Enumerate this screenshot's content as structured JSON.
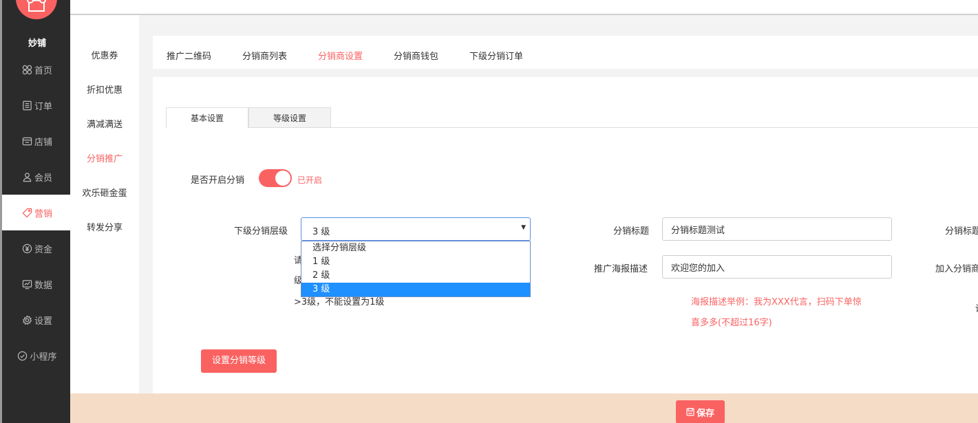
{
  "brand": "妙铺",
  "nav": [
    {
      "label": "首页",
      "icon": "home-icon"
    },
    {
      "label": "订单",
      "icon": "order-icon"
    },
    {
      "label": "店铺",
      "icon": "shop-icon"
    },
    {
      "label": "会员",
      "icon": "member-icon"
    },
    {
      "label": "营销",
      "icon": "tag-icon",
      "active": true
    },
    {
      "label": "资金",
      "icon": "money-icon"
    },
    {
      "label": "数据",
      "icon": "chart-icon"
    },
    {
      "label": "设置",
      "icon": "gear-icon"
    },
    {
      "label": "小程序",
      "icon": "miniprogram-icon"
    }
  ],
  "subnav": [
    "优惠券",
    "折扣优惠",
    "满减满送",
    "分销推广",
    "欢乐砸金蛋",
    "转发分享"
  ],
  "tabs": [
    "推广二维码",
    "分销商列表",
    "分销商设置",
    "分销商钱包",
    "下级分销订单"
  ],
  "subtabs": [
    "基本设置",
    "等级设置"
  ],
  "form": {
    "enable_label": "是否开启分销",
    "enable_state": "已开启",
    "level_label": "下级分销层级",
    "level_value": "3 级",
    "level_options": [
      "选择分销层级",
      "1 级",
      "2 级",
      "3 级"
    ],
    "hint_line1": "请",
    "hint_line2": "级",
    "hint_line3": ">3级，不能设置为1级",
    "title_label": "分销标题",
    "title_value": "分销标题测试",
    "poster_label": "推广海报描述",
    "poster_value": "欢迎您的加入",
    "poster_hint_1": "海报描述举例：我为XXX代言，扫码下单惊",
    "poster_hint_2": "喜多多(不超过16字)",
    "right_label_1": "分销标题",
    "right_label_2": "加入分销商",
    "right_label_3": "说",
    "level_button": "设置分销等级"
  },
  "save_label": "保存",
  "colors": {
    "accent": "#fa6262",
    "sidebar": "#2b2b2b",
    "footer": "#f5dcc7"
  }
}
